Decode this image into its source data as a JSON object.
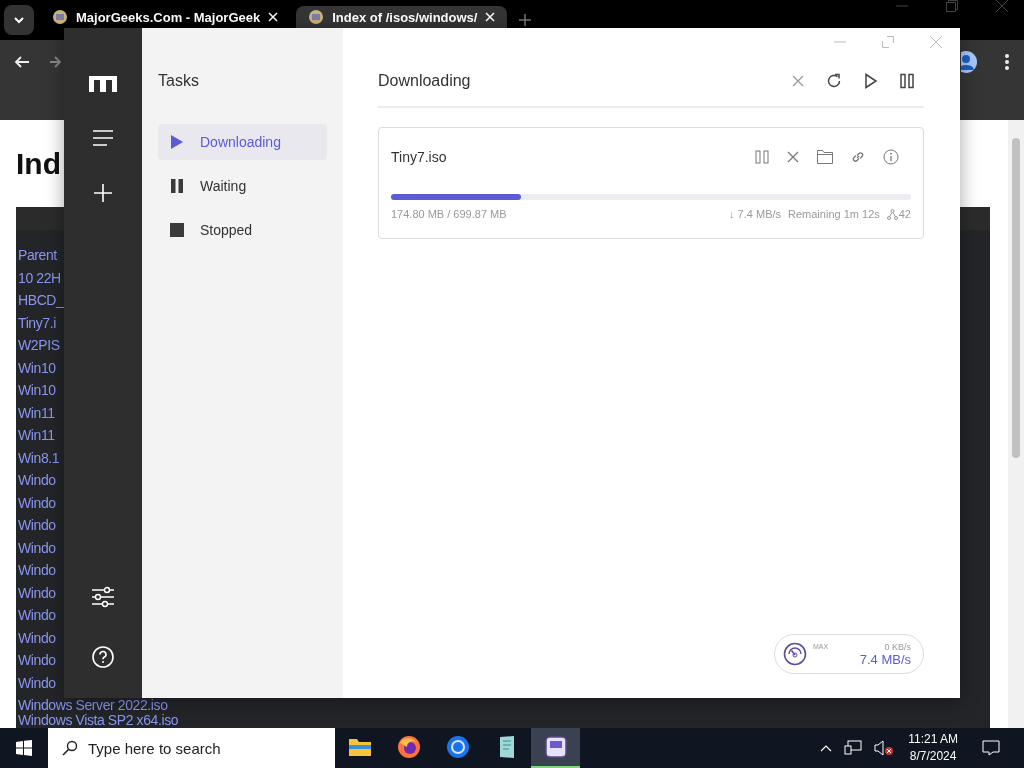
{
  "browser": {
    "tabs": [
      {
        "title": "MajorGeeks.Com - MajorGeek",
        "selected": false
      },
      {
        "title": "Index of /isos/windows/",
        "selected": true
      }
    ],
    "page": {
      "heading": "Ind",
      "listing": [
        "Parent",
        "10 22H",
        "HBCD_",
        "Tiny7.i",
        "W2PIS",
        "Win10",
        "Win10",
        "Win11",
        "Win11",
        "Win8.1",
        "Windo",
        "Windo",
        "Windo",
        "Windo",
        "Windo",
        "Windo",
        "Windo",
        "Windo",
        "Windo",
        "Windo",
        "Windows Server 2022.iso",
        "Windows Vista SP2 x64.iso"
      ]
    }
  },
  "app": {
    "sidebar_title": "Tasks",
    "filters": [
      {
        "label": "Downloading",
        "kind": "downloading",
        "selected": true
      },
      {
        "label": "Waiting",
        "kind": "waiting",
        "selected": false
      },
      {
        "label": "Stopped",
        "kind": "stopped",
        "selected": false
      }
    ],
    "header": "Downloading",
    "tasks": [
      {
        "name": "Tiny7.iso",
        "level": 0.25,
        "size": "174.80 MB / 699.87 MB",
        "speed": "↓ 7.4 MB/s",
        "remaining": "Remaining 1m 12s",
        "connections": "42"
      }
    ],
    "speed_meter": {
      "label": "MAX",
      "upload": "0 KB/s",
      "download": "7.4 MB/s"
    }
  },
  "taskbar": {
    "search": {
      "placeholder": "Type here to search"
    },
    "apps": [
      {
        "kind": "folder",
        "selected": false
      },
      {
        "kind": "firefox",
        "selected": false
      },
      {
        "kind": "chrome",
        "selected": false
      },
      {
        "kind": "notepad",
        "selected": false
      },
      {
        "kind": "downloader",
        "selected": true
      }
    ],
    "clock": {
      "time": "11:21 AM",
      "date": "8/7/2024"
    }
  }
}
